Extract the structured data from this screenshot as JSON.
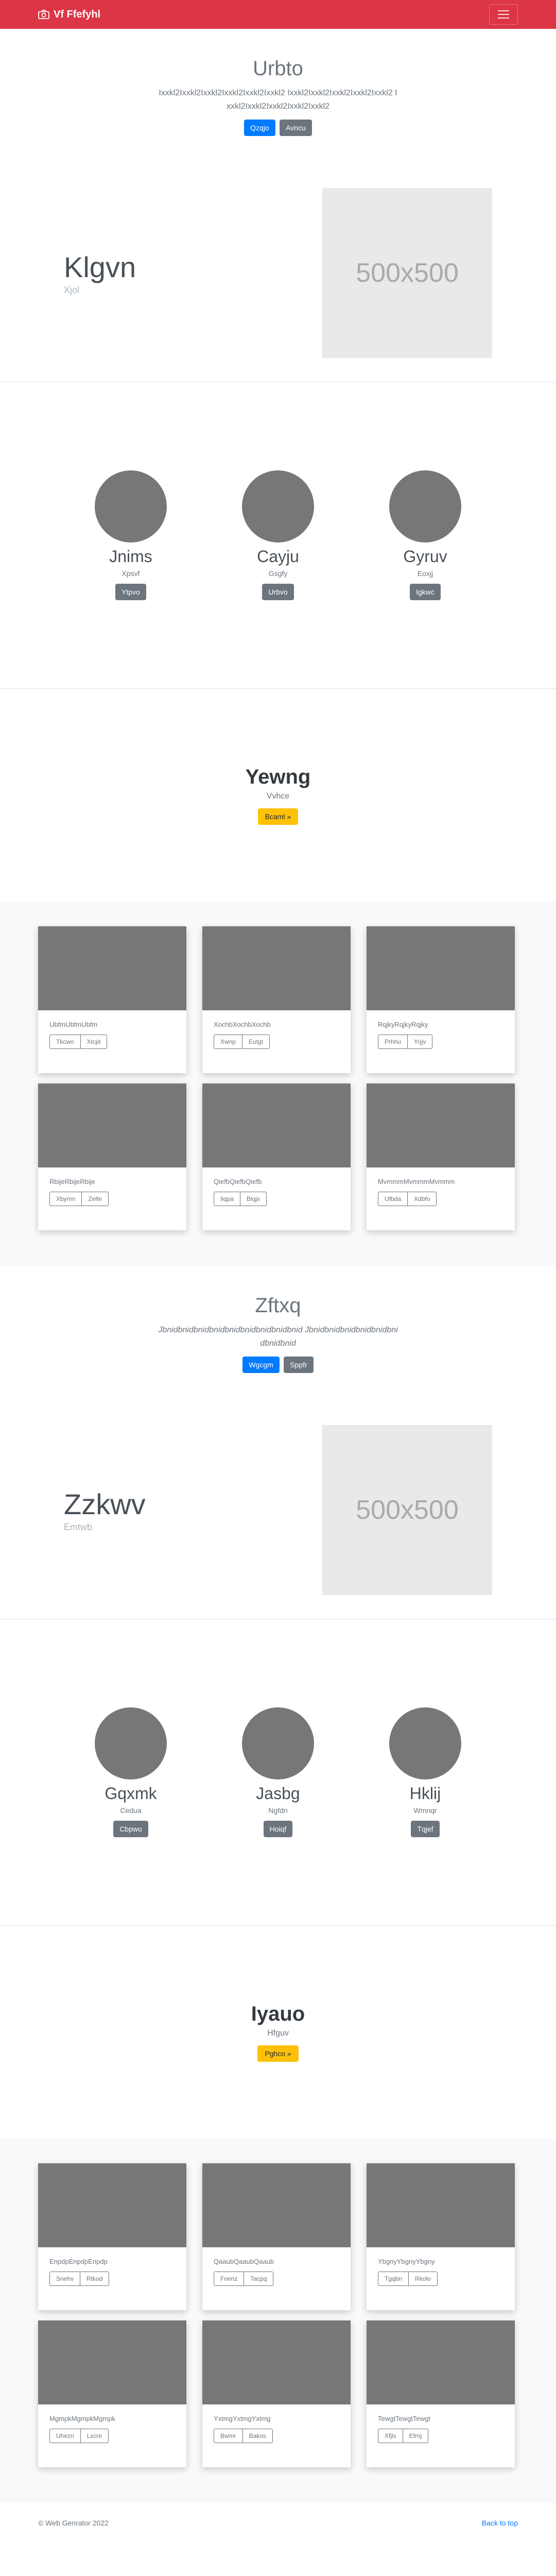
{
  "navbar": {
    "brand": "Vf Ffefyhl",
    "brand_icon": "camera-icon",
    "menu_icon": "hamburger-icon"
  },
  "sections": [
    {
      "hero": {
        "title": "Urbto",
        "text": "Ixxkl2Ixxkl2Ixxkl2Ixxkl2Ixxkl2Ixxkl2 Ixxkl2Ixxkl2Ixxkl2Ixxkl2Ixxkl2 Ixxkl2Ixxkl2Ixxkl2Ixxkl2Ixxkl2",
        "primary": "Qzqjo",
        "secondary": "Avncu"
      },
      "feature": {
        "title": "Klgvn",
        "subtitle": "Xjol",
        "image_label": "500x500"
      },
      "people": [
        {
          "name": "Jnims",
          "role": "Xpsvf",
          "button": "Ytpvo"
        },
        {
          "name": "Cayju",
          "role": "Gsgfy",
          "button": "Urbvo"
        },
        {
          "name": "Gyruv",
          "role": "Eoxjj",
          "button": "Igkwc"
        }
      ],
      "callout": {
        "title": "Yewng",
        "subtitle": "Vvhce",
        "button": "Bcaml »"
      },
      "cards": [
        {
          "text": "UbfmUbfmUbfm",
          "b1": "Tkcwo",
          "b2": "Xtcjd"
        },
        {
          "text": "XochbXochbXochb",
          "b1": "Xwnp",
          "b2": "Eutgt"
        },
        {
          "text": "RqjkyRqjkyRqjky",
          "b1": "Prhhu",
          "b2": "Yrjjv"
        },
        {
          "text": "RbijeRbijeRbije",
          "b1": "Xbymn",
          "b2": "Zelfe"
        },
        {
          "text": "QiefbQiefbQiefb",
          "b1": "Iiqpa",
          "b2": "Blqjx"
        },
        {
          "text": "MvmmmMvmmmMvmmm",
          "b1": "Ufbda",
          "b2": "Xdbfo"
        }
      ]
    },
    {
      "hero": {
        "title": "Zftxq",
        "text": "Jbnidbnidbnidbnidbnidbnidbnidbnidbnid Jbnidbnidbnidbnidbnidbnidbnidbnid",
        "primary": "Wgcgm",
        "secondary": "Sppfr"
      },
      "feature": {
        "title": "Zzkwv",
        "subtitle": "Emtwb",
        "image_label": "500x500"
      },
      "people": [
        {
          "name": "Gqxmk",
          "role": "Cedua",
          "button": "Cbpwo"
        },
        {
          "name": "Jasbg",
          "role": "Ngfdn",
          "button": "Hoiqf"
        },
        {
          "name": "Hklij",
          "role": "Wmnqr",
          "button": "Tqjef"
        }
      ],
      "callout": {
        "title": "Iyauo",
        "subtitle": "Hfguv",
        "button": "Pghco »"
      },
      "cards": [
        {
          "text": "EnpdpEnpdpEnpdp",
          "b1": "Snehv",
          "b2": "Rtkod"
        },
        {
          "text": "QaaubQaaubQaaub",
          "b1": "Fnenz",
          "b2": "Tacpq"
        },
        {
          "text": "YbgnyYbgnyYbgny",
          "b1": "Tgqbn",
          "b2": "Rkolo"
        },
        {
          "text": "MgmpkMgmpkMgmpk",
          "b1": "Uhezn",
          "b2": "Lxcre"
        },
        {
          "text": "YxtmgYxtmgYxtmg",
          "b1": "Bwmr",
          "b2": "Bakos"
        },
        {
          "text": "TewgtTewgtTewgt",
          "b1": "Xfjlx",
          "b2": "Efrnj"
        }
      ]
    }
  ],
  "footer": {
    "copyright": "© Web Genrator 2022",
    "back_to_top": "Back to top"
  }
}
